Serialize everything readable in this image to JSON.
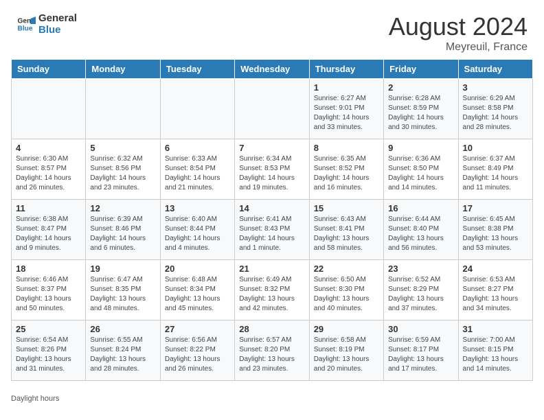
{
  "header": {
    "logo_line1": "General",
    "logo_line2": "Blue",
    "month": "August 2024",
    "location": "Meyreuil, France"
  },
  "weekdays": [
    "Sunday",
    "Monday",
    "Tuesday",
    "Wednesday",
    "Thursday",
    "Friday",
    "Saturday"
  ],
  "weeks": [
    [
      {
        "day": "",
        "info": ""
      },
      {
        "day": "",
        "info": ""
      },
      {
        "day": "",
        "info": ""
      },
      {
        "day": "",
        "info": ""
      },
      {
        "day": "1",
        "info": "Sunrise: 6:27 AM\nSunset: 9:01 PM\nDaylight: 14 hours\nand 33 minutes."
      },
      {
        "day": "2",
        "info": "Sunrise: 6:28 AM\nSunset: 8:59 PM\nDaylight: 14 hours\nand 30 minutes."
      },
      {
        "day": "3",
        "info": "Sunrise: 6:29 AM\nSunset: 8:58 PM\nDaylight: 14 hours\nand 28 minutes."
      }
    ],
    [
      {
        "day": "4",
        "info": "Sunrise: 6:30 AM\nSunset: 8:57 PM\nDaylight: 14 hours\nand 26 minutes."
      },
      {
        "day": "5",
        "info": "Sunrise: 6:32 AM\nSunset: 8:56 PM\nDaylight: 14 hours\nand 23 minutes."
      },
      {
        "day": "6",
        "info": "Sunrise: 6:33 AM\nSunset: 8:54 PM\nDaylight: 14 hours\nand 21 minutes."
      },
      {
        "day": "7",
        "info": "Sunrise: 6:34 AM\nSunset: 8:53 PM\nDaylight: 14 hours\nand 19 minutes."
      },
      {
        "day": "8",
        "info": "Sunrise: 6:35 AM\nSunset: 8:52 PM\nDaylight: 14 hours\nand 16 minutes."
      },
      {
        "day": "9",
        "info": "Sunrise: 6:36 AM\nSunset: 8:50 PM\nDaylight: 14 hours\nand 14 minutes."
      },
      {
        "day": "10",
        "info": "Sunrise: 6:37 AM\nSunset: 8:49 PM\nDaylight: 14 hours\nand 11 minutes."
      }
    ],
    [
      {
        "day": "11",
        "info": "Sunrise: 6:38 AM\nSunset: 8:47 PM\nDaylight: 14 hours\nand 9 minutes."
      },
      {
        "day": "12",
        "info": "Sunrise: 6:39 AM\nSunset: 8:46 PM\nDaylight: 14 hours\nand 6 minutes."
      },
      {
        "day": "13",
        "info": "Sunrise: 6:40 AM\nSunset: 8:44 PM\nDaylight: 14 hours\nand 4 minutes."
      },
      {
        "day": "14",
        "info": "Sunrise: 6:41 AM\nSunset: 8:43 PM\nDaylight: 14 hours\nand 1 minute."
      },
      {
        "day": "15",
        "info": "Sunrise: 6:43 AM\nSunset: 8:41 PM\nDaylight: 13 hours\nand 58 minutes."
      },
      {
        "day": "16",
        "info": "Sunrise: 6:44 AM\nSunset: 8:40 PM\nDaylight: 13 hours\nand 56 minutes."
      },
      {
        "day": "17",
        "info": "Sunrise: 6:45 AM\nSunset: 8:38 PM\nDaylight: 13 hours\nand 53 minutes."
      }
    ],
    [
      {
        "day": "18",
        "info": "Sunrise: 6:46 AM\nSunset: 8:37 PM\nDaylight: 13 hours\nand 50 minutes."
      },
      {
        "day": "19",
        "info": "Sunrise: 6:47 AM\nSunset: 8:35 PM\nDaylight: 13 hours\nand 48 minutes."
      },
      {
        "day": "20",
        "info": "Sunrise: 6:48 AM\nSunset: 8:34 PM\nDaylight: 13 hours\nand 45 minutes."
      },
      {
        "day": "21",
        "info": "Sunrise: 6:49 AM\nSunset: 8:32 PM\nDaylight: 13 hours\nand 42 minutes."
      },
      {
        "day": "22",
        "info": "Sunrise: 6:50 AM\nSunset: 8:30 PM\nDaylight: 13 hours\nand 40 minutes."
      },
      {
        "day": "23",
        "info": "Sunrise: 6:52 AM\nSunset: 8:29 PM\nDaylight: 13 hours\nand 37 minutes."
      },
      {
        "day": "24",
        "info": "Sunrise: 6:53 AM\nSunset: 8:27 PM\nDaylight: 13 hours\nand 34 minutes."
      }
    ],
    [
      {
        "day": "25",
        "info": "Sunrise: 6:54 AM\nSunset: 8:26 PM\nDaylight: 13 hours\nand 31 minutes."
      },
      {
        "day": "26",
        "info": "Sunrise: 6:55 AM\nSunset: 8:24 PM\nDaylight: 13 hours\nand 28 minutes."
      },
      {
        "day": "27",
        "info": "Sunrise: 6:56 AM\nSunset: 8:22 PM\nDaylight: 13 hours\nand 26 minutes."
      },
      {
        "day": "28",
        "info": "Sunrise: 6:57 AM\nSunset: 8:20 PM\nDaylight: 13 hours\nand 23 minutes."
      },
      {
        "day": "29",
        "info": "Sunrise: 6:58 AM\nSunset: 8:19 PM\nDaylight: 13 hours\nand 20 minutes."
      },
      {
        "day": "30",
        "info": "Sunrise: 6:59 AM\nSunset: 8:17 PM\nDaylight: 13 hours\nand 17 minutes."
      },
      {
        "day": "31",
        "info": "Sunrise: 7:00 AM\nSunset: 8:15 PM\nDaylight: 13 hours\nand 14 minutes."
      }
    ]
  ],
  "footer": {
    "daylight_label": "Daylight hours"
  }
}
